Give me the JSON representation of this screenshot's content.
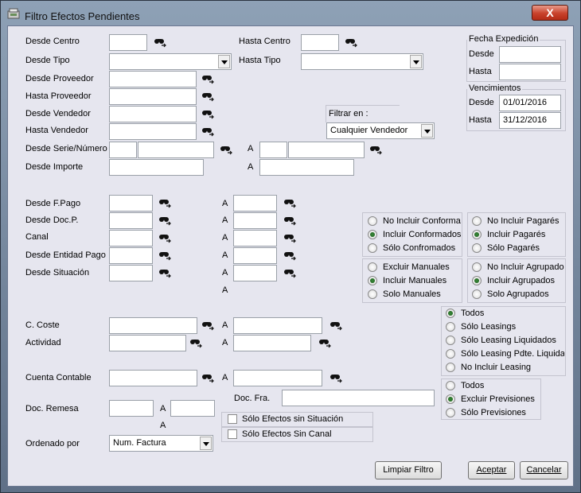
{
  "window": {
    "title": "Filtro Efectos Pendientes",
    "close": "X"
  },
  "labels": {
    "desde_centro": "Desde Centro",
    "hasta_centro": "Hasta Centro",
    "desde_tipo": "Desde Tipo",
    "hasta_tipo": "Hasta Tipo",
    "desde_proveedor": "Desde Proveedor",
    "hasta_proveedor": "Hasta Proveedor",
    "desde_vendedor": "Desde Vendedor",
    "hasta_vendedor": "Hasta Vendedor",
    "desde_serie": "Desde Serie/Número",
    "desde_importe": "Desde Importe",
    "desde_fpago": "Desde F.Pago",
    "desde_docp": "Desde Doc.P.",
    "canal": "Canal",
    "desde_entidad": "Desde Entidad Pago",
    "desde_situacion": "Desde Situación",
    "c_coste": "C. Coste",
    "actividad": "Actividad",
    "cuenta_contable": "Cuenta Contable",
    "doc_remesa": "Doc. Remesa",
    "doc_fra": "Doc. Fra.",
    "ordenado_por": "Ordenado por",
    "a": "A",
    "filtrar_en": "Filtrar en :"
  },
  "fecha_expedicion": {
    "title": "Fecha Expedición",
    "desde_label": "Desde",
    "hasta_label": "Hasta",
    "desde": "",
    "hasta": ""
  },
  "vencimientos": {
    "title": "Vencimientos",
    "desde_label": "Desde",
    "hasta_label": "Hasta",
    "desde": "01/01/2016",
    "hasta": "31/12/2016"
  },
  "filtrar_en_value": "Cualquier Vendedor",
  "ordenado_por_value": "Num. Factura",
  "radio_groups": {
    "conformados": [
      "No Incluir Conformados",
      "Incluir Conformados",
      "Sólo Confromados"
    ],
    "pagares": [
      "No Incluir Pagarés",
      "Incluir Pagarés",
      "Sólo Pagarés"
    ],
    "manuales": [
      "Excluir Manuales",
      "Incluir Manuales",
      "Solo Manuales"
    ],
    "agrupados": [
      "No Incluir Agrupados",
      "Incluir Agrupados",
      "Solo Agrupados"
    ],
    "leasing": [
      "Todos",
      "Sólo Leasings",
      "Sólo Leasing Liquidados",
      "Sólo Leasing Pdte. Liquidar",
      "No Incluir Leasing"
    ],
    "previsiones": [
      "Todos",
      "Excluir Previsiones",
      "Sólo Previsiones"
    ]
  },
  "checkboxes": {
    "sin_situacion": "Sólo Efectos sin Situación",
    "sin_canal": "Sólo Efectos Sin Canal"
  },
  "buttons": {
    "limpiar": "Limpiar Filtro",
    "aceptar": "Aceptar",
    "cancelar": "Cancelar"
  }
}
